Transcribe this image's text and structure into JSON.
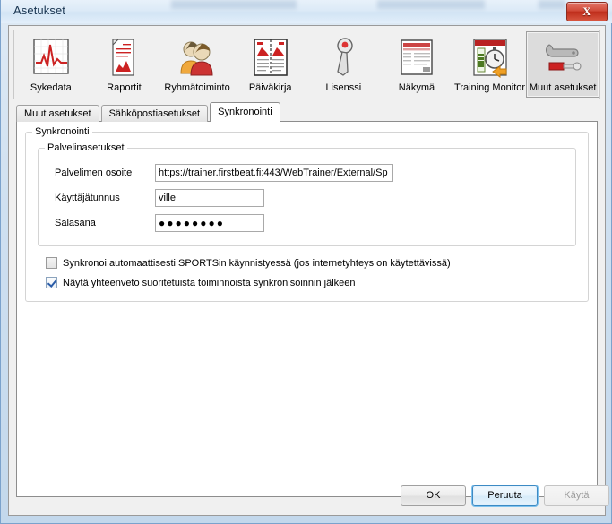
{
  "window": {
    "title": "Asetukset",
    "close_label": "X",
    "close_icon": "close-icon"
  },
  "toolbar": {
    "items": [
      {
        "label": "Sykedata",
        "icon": "heart-rate-chart-icon",
        "selected": false
      },
      {
        "label": "Raportit",
        "icon": "report-document-icon",
        "selected": false
      },
      {
        "label": "Ryhmätoiminto",
        "icon": "group-people-icon",
        "selected": false
      },
      {
        "label": "Päiväkirja",
        "icon": "open-book-icon",
        "selected": false
      },
      {
        "label": "Lisenssi",
        "icon": "key-icon",
        "selected": false
      },
      {
        "label": "Näkymä",
        "icon": "window-layout-icon",
        "selected": false
      },
      {
        "label": "Training Monitor",
        "icon": "stopwatch-gauge-icon",
        "selected": false
      },
      {
        "label": "Muut asetukset",
        "icon": "wrench-tools-icon",
        "selected": true
      }
    ]
  },
  "tabs": [
    {
      "label": "Muut asetukset",
      "active": false
    },
    {
      "label": "Sähköpostiasetukset",
      "active": false
    },
    {
      "label": "Synkronointi",
      "active": true
    }
  ],
  "groups": {
    "sync_legend": "Synkronointi",
    "server_legend": "Palvelinasetukset"
  },
  "fields": {
    "server_label": "Palvelimen osoite",
    "server_value": "https://trainer.firstbeat.fi:443/WebTrainer/External/Sp",
    "username_label": "Käyttäjätunnus",
    "username_value": "ville",
    "password_label": "Salasana",
    "password_value": "●●●●●●●●"
  },
  "checkboxes": [
    {
      "label": "Synkronoi automaattisesti SPORTSin käynnistyessä (jos internetyhteys on käytettävissä)",
      "checked": false
    },
    {
      "label": "Näytä yhteenveto suoritetuista toiminnoista synkronisoinnin jälkeen",
      "checked": true
    }
  ],
  "footer": {
    "ok_label": "OK",
    "cancel_label": "Peruuta",
    "apply_label": "Käytä",
    "apply_disabled": true
  },
  "colors": {
    "accent_red": "#c62a1c",
    "accent_blue": "#3c8ac4",
    "title_text": "#17334f",
    "panel_bg": "#f0f0f0"
  }
}
